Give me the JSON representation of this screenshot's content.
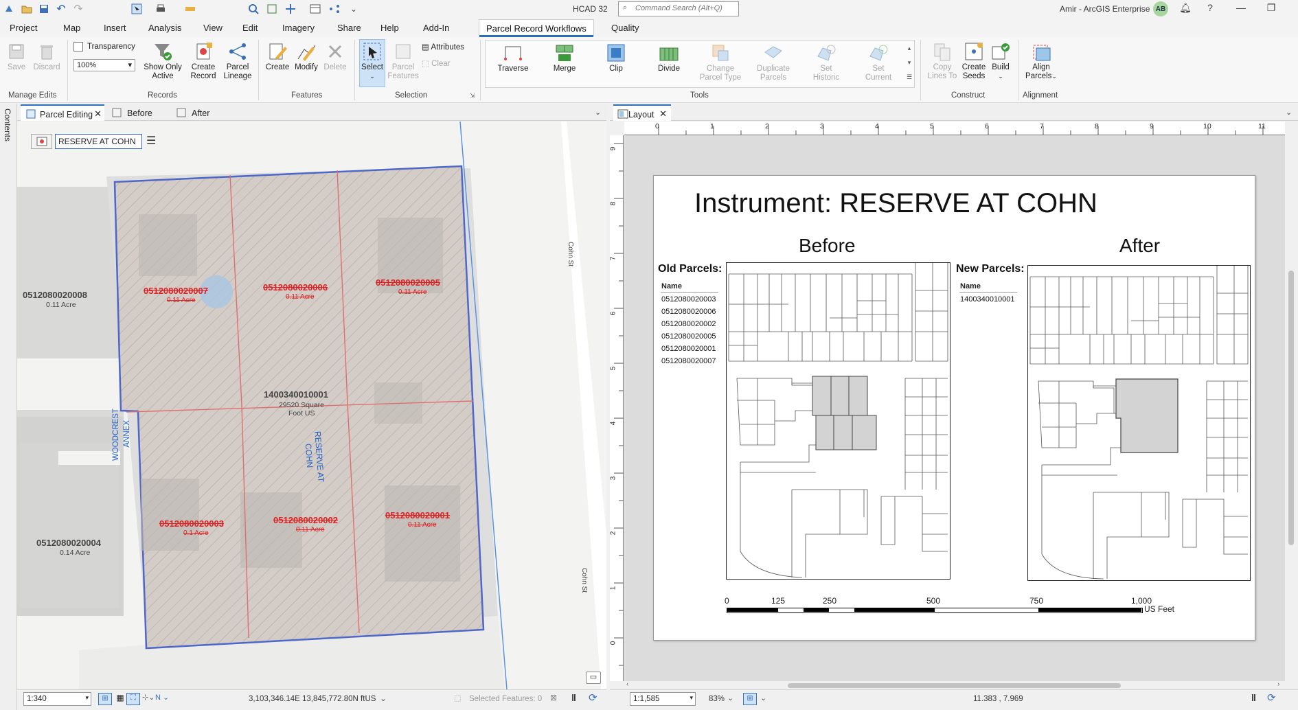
{
  "titlebar": {
    "app_title": "HCAD 32",
    "search_placeholder": "Command Search (Alt+Q)",
    "user": "Amir - ArcGIS Enterprise",
    "avatar_initials": "AB"
  },
  "menu": [
    "Project",
    "Map",
    "Insert",
    "Analysis",
    "View",
    "Edit",
    "Imagery",
    "Share",
    "Help",
    "Add-In"
  ],
  "context_tabs": {
    "active": "Parcel Record Workflows",
    "other": "Quality"
  },
  "ribbon": {
    "manage_edits": {
      "save": "Save",
      "discard": "Discard",
      "label": "Manage Edits"
    },
    "records": {
      "transparency": "Transparency",
      "transparency_value": "100%",
      "show_only_active": [
        "Show Only",
        "Active"
      ],
      "create_record": [
        "Create",
        "Record"
      ],
      "parcel_lineage": [
        "Parcel",
        "Lineage"
      ],
      "label": "Records"
    },
    "features": {
      "create": "Create",
      "modify": "Modify",
      "delete": "Delete",
      "label": "Features"
    },
    "selection": {
      "select": "Select",
      "parcel_features": [
        "Parcel",
        "Features"
      ],
      "attributes": "Attributes",
      "clear": "Clear",
      "label": "Selection"
    },
    "tools": {
      "traverse": "Traverse",
      "merge": "Merge",
      "clip": "Clip",
      "divide": "Divide",
      "change_parcel_type": [
        "Change",
        "Parcel Type"
      ],
      "duplicate_parcels": [
        "Duplicate",
        "Parcels"
      ],
      "set_historic": [
        "Set",
        "Historic"
      ],
      "set_current": [
        "Set",
        "Current"
      ],
      "label": "Tools"
    },
    "construct": {
      "copy_lines_to": [
        "Copy",
        "Lines To"
      ],
      "create_seeds": [
        "Create",
        "Seeds"
      ],
      "build": "Build",
      "label": "Construct"
    },
    "alignment": {
      "align_parcels": [
        "Align",
        "Parcels"
      ],
      "label": "Alignment"
    }
  },
  "contents_label": "Contents",
  "map_tabs": [
    "Parcel Editing",
    "Before",
    "After"
  ],
  "instrument_value": "RESERVE AT COHN",
  "map": {
    "outside_parcels": [
      {
        "id": "0512080020008",
        "area": "0.11 Acre"
      },
      {
        "id": "0512080020004",
        "area": "0.14 Acre"
      }
    ],
    "historic_parcels": [
      {
        "id": "0512080020007",
        "area": "0.11 Acre"
      },
      {
        "id": "0512080020006",
        "area": "0.11 Acre"
      },
      {
        "id": "0512080020005",
        "area": "0.11 Acre"
      },
      {
        "id": "0512080020003",
        "area": "0.1 Acre"
      },
      {
        "id": "0512080020002",
        "area": "0.11 Acre"
      },
      {
        "id": "0512080020001",
        "area": "0.11 Acre"
      }
    ],
    "new_parcel": {
      "id": "1400340010001",
      "area_line1": "29520 Square",
      "area_line2": "Foot US"
    },
    "record_label": [
      "RESERVE AT",
      "COHN"
    ],
    "annex_label": [
      "WOODCREST",
      "ANNEX"
    ],
    "street": "Cohn St"
  },
  "status_left": {
    "scale": "1:340",
    "coords": "3,103,346.14E 13,845,772.80N ftUS",
    "selected": "Selected Features: 0"
  },
  "layout_tab": "Layout",
  "ruler_top": [
    "0",
    "1",
    "2",
    "3",
    "4",
    "5",
    "6",
    "7",
    "8",
    "9",
    "10",
    "11"
  ],
  "ruler_left": [
    "9",
    "8",
    "7",
    "6",
    "5",
    "4",
    "3",
    "2",
    "1",
    "0"
  ],
  "layout": {
    "title": "Instrument: RESERVE AT COHN",
    "before": "Before",
    "after": "After",
    "old_parcels": {
      "heading": "Old Parcels:",
      "col": "Name",
      "rows": [
        "0512080020003",
        "0512080020006",
        "0512080020002",
        "0512080020005",
        "0512080020001",
        "0512080020007"
      ]
    },
    "new_parcels": {
      "heading": "New Parcels:",
      "col": "Name",
      "rows": [
        "1400340010001"
      ]
    },
    "scalebar": {
      "ticks": [
        "0",
        "125",
        "250",
        "500",
        "750",
        "1,000"
      ],
      "units": "US Feet"
    }
  },
  "status_right": {
    "scale": "1:1,585",
    "zoom": "83%",
    "coords": "11.383 , 7.969"
  }
}
